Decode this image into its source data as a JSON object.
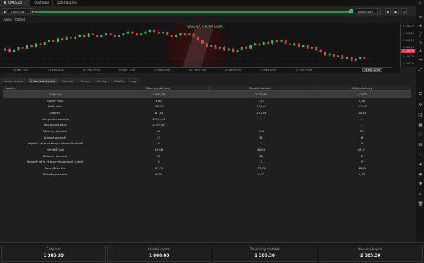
{
  "tabs": [
    {
      "label": "UAKS.20",
      "active": true
    },
    {
      "label": "Obchodní",
      "active": false
    },
    {
      "label": "Optimalizace",
      "active": false
    }
  ],
  "playback": {
    "start_date": "03/05/2017",
    "end_date": "20/04/2020",
    "progress": 1.0
  },
  "chart": {
    "symbol_label": "Cena / Vážené",
    "banner": "VÁŽENÁ TIKOVÁ DATA",
    "price_labels": [
      "6 200,00",
      "6 000,00",
      "5 800,00",
      "5 600,00",
      "5 400,00",
      "5 200,00"
    ],
    "current_price": "5 474,00",
    "time_labels": [
      "01 Mar 2020",
      "02 Mar 12:00",
      "04 Mar 00:00",
      "05 Mar 12:00",
      "07 Mar 00:00",
      "08 Mar 12:00",
      "10 Mar 00:00",
      "11 Mar 12:00",
      "13 Mar 00:00",
      "14 Mar 12:00"
    ],
    "current_time": "14 Mar 12:00",
    "candles": [
      {
        "o": 54,
        "c": 55
      },
      {
        "o": 55,
        "c": 53
      },
      {
        "o": 53,
        "c": 54
      },
      {
        "o": 54,
        "c": 56
      },
      {
        "o": 56,
        "c": 55
      },
      {
        "o": 55,
        "c": 57
      },
      {
        "o": 57,
        "c": 56
      },
      {
        "o": 56,
        "c": 58
      },
      {
        "o": 58,
        "c": 57
      },
      {
        "o": 57,
        "c": 59
      },
      {
        "o": 59,
        "c": 60
      },
      {
        "o": 60,
        "c": 59
      },
      {
        "o": 59,
        "c": 61
      },
      {
        "o": 61,
        "c": 60
      },
      {
        "o": 60,
        "c": 62
      },
      {
        "o": 62,
        "c": 61
      },
      {
        "o": 61,
        "c": 62
      },
      {
        "o": 62,
        "c": 63
      },
      {
        "o": 63,
        "c": 62
      },
      {
        "o": 62,
        "c": 64
      },
      {
        "o": 64,
        "c": 63
      },
      {
        "o": 63,
        "c": 62
      },
      {
        "o": 62,
        "c": 63
      },
      {
        "o": 63,
        "c": 64
      },
      {
        "o": 64,
        "c": 63
      },
      {
        "o": 63,
        "c": 62
      },
      {
        "o": 62,
        "c": 63
      },
      {
        "o": 63,
        "c": 64
      },
      {
        "o": 64,
        "c": 65
      },
      {
        "o": 65,
        "c": 64
      },
      {
        "o": 64,
        "c": 63
      },
      {
        "o": 63,
        "c": 64
      },
      {
        "o": 64,
        "c": 65
      },
      {
        "o": 65,
        "c": 66
      },
      {
        "o": 66,
        "c": 65
      },
      {
        "o": 65,
        "c": 64
      },
      {
        "o": 64,
        "c": 65
      },
      {
        "o": 65,
        "c": 63
      },
      {
        "o": 63,
        "c": 62
      },
      {
        "o": 62,
        "c": 63
      },
      {
        "o": 63,
        "c": 64
      },
      {
        "o": 64,
        "c": 63
      },
      {
        "o": 63,
        "c": 64
      },
      {
        "o": 64,
        "c": 62
      },
      {
        "o": 62,
        "c": 60
      },
      {
        "o": 60,
        "c": 58
      },
      {
        "o": 58,
        "c": 56
      },
      {
        "o": 56,
        "c": 57
      },
      {
        "o": 57,
        "c": 55
      },
      {
        "o": 55,
        "c": 56
      },
      {
        "o": 56,
        "c": 54
      },
      {
        "o": 54,
        "c": 55
      },
      {
        "o": 55,
        "c": 53
      },
      {
        "o": 53,
        "c": 54
      },
      {
        "o": 54,
        "c": 56
      },
      {
        "o": 56,
        "c": 55
      },
      {
        "o": 55,
        "c": 57
      },
      {
        "o": 57,
        "c": 58
      },
      {
        "o": 58,
        "c": 57
      },
      {
        "o": 57,
        "c": 59
      },
      {
        "o": 59,
        "c": 58
      },
      {
        "o": 58,
        "c": 60
      },
      {
        "o": 60,
        "c": 59
      },
      {
        "o": 59,
        "c": 60
      },
      {
        "o": 60,
        "c": 58
      },
      {
        "o": 58,
        "c": 57
      },
      {
        "o": 57,
        "c": 58
      },
      {
        "o": 58,
        "c": 56
      },
      {
        "o": 56,
        "c": 57
      },
      {
        "o": 57,
        "c": 55
      },
      {
        "o": 55,
        "c": 56
      },
      {
        "o": 56,
        "c": 54
      },
      {
        "o": 54,
        "c": 53
      },
      {
        "o": 53,
        "c": 51
      },
      {
        "o": 51,
        "c": 52
      },
      {
        "o": 52,
        "c": 50
      },
      {
        "o": 50,
        "c": 51
      },
      {
        "o": 51,
        "c": 49
      },
      {
        "o": 49,
        "c": 50
      },
      {
        "o": 50,
        "c": 48
      },
      {
        "o": 48,
        "c": 49
      },
      {
        "o": 49,
        "c": 50
      },
      {
        "o": 50,
        "c": 49
      }
    ],
    "colors": {
      "up": "#2fbf5a",
      "down": "#e0413a",
      "accent": "#1e9a4b",
      "current_price_bg": "#d93b3b"
    }
  },
  "subtabs": [
    {
      "label": "Vlastní kapitál",
      "active": false
    },
    {
      "label": "Výkonnostní sheet",
      "active": true
    },
    {
      "label": "Obchody",
      "active": false
    },
    {
      "label": "Pozice",
      "active": false
    },
    {
      "label": "Metriky",
      "active": false
    },
    {
      "label": "Záložky",
      "active": false
    },
    {
      "label": "Log",
      "active": false
    }
  ],
  "table": {
    "headers": [
      "Souhrn",
      "Všechny obchody",
      "Dlouhé obchody",
      "Krátké obchody"
    ],
    "rows": [
      {
        "cells": [
          "Čistý zisk",
          "1 385,30",
          "1 213,30",
          "172,00"
        ],
        "selected": true
      },
      {
        "cells": [
          "Faktor zisku",
          "1,82",
          "1,93",
          "1,40"
        ],
        "selected": false
      },
      {
        "cells": [
          "Podíl zisku",
          "-251,44",
          "-110,04",
          "-141,40"
        ],
        "selected": false
      },
      {
        "cells": [
          "Sharpe",
          "-87,64",
          "-124,06",
          "-10,56"
        ],
        "selected": false
      },
      {
        "cells": [
          "Max pokles kapitálu",
          "-1 324,96",
          "–",
          "–"
        ],
        "selected": false
      },
      {
        "cells": [
          "Max pokles zisku",
          "-1 372,60",
          "–",
          "–"
        ],
        "selected": false
      },
      {
        "cells": [
          "Všechny obchody",
          "61",
          "101",
          "36"
        ],
        "selected": false
      },
      {
        "cells": [
          "Ziskové obchody",
          "33",
          "31",
          "8"
        ],
        "selected": false
      },
      {
        "cells": [
          "Nejdelší série ziskových obchodů v řadě",
          "5",
          "3",
          "4"
        ],
        "selected": false
      },
      {
        "cells": [
          "Největší zisk",
          "44,66",
          "44,06",
          "48,07"
        ],
        "selected": false
      },
      {
        "cells": [
          "Ztrátové obchody",
          "52",
          "40",
          "2"
        ],
        "selected": false
      },
      {
        "cells": [
          "Nejdelší série ztrátových obchodů v řadě",
          "5",
          "3",
          "5"
        ],
        "selected": false
      },
      {
        "cells": [
          "Největší ztráta",
          "-57,74",
          "-57,74",
          "-40,05"
        ],
        "selected": false
      },
      {
        "cells": [
          "Průměrný obchod",
          "6,17",
          "6,02",
          "5,73"
        ],
        "selected": false
      }
    ]
  },
  "summary": [
    {
      "label": "Čistý zisk",
      "value": "1 385,30"
    },
    {
      "label": "Úvodní kapitál",
      "value": "1 000,00"
    },
    {
      "label": "Závěrečný zůstatek",
      "value": "2 385,30"
    },
    {
      "label": "Konečný kapitál",
      "value": "2 385,30"
    }
  ]
}
